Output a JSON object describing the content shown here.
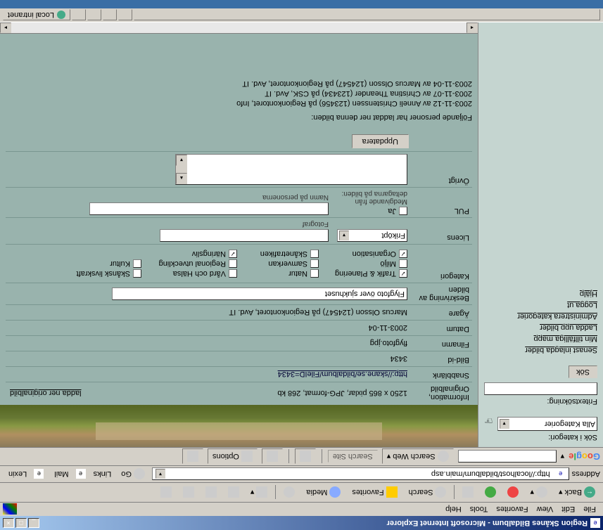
{
  "titlebar": {
    "text": "Region Skånes Bildalbum - Microsoft Internet Explorer"
  },
  "menu": {
    "file": "File",
    "edit": "Edit",
    "view": "View",
    "favorites": "Favorites",
    "tools": "Tools",
    "help": "Help"
  },
  "toolbar": {
    "back": "Back",
    "search": "Search",
    "favorites": "Favorites",
    "media": "Media"
  },
  "address": {
    "label": "Address",
    "url": "http://localhost/bildalbum/main.asp",
    "go": "Go",
    "links": "Links",
    "mail": "Mail",
    "lexin": "Lexin"
  },
  "google": {
    "searchweb": "Search Web",
    "searchsite": "Search Site",
    "options": "Options"
  },
  "sidebar": {
    "category_label": "Sök i kategori:",
    "category_value": "Alla Kategorier",
    "freetext_label": "Fritextsökning:",
    "search_btn": "Sök",
    "links": {
      "recent": "Senast inlagda bilder",
      "tempfolder": "Min tillfälliga mapp",
      "upload": "Ladda upp bilder",
      "admin": "Administrera kategorier",
      "logout": "Logga ut",
      "help": "Hjälp"
    }
  },
  "form": {
    "info_label": "Information, Originalbild",
    "info_value": "1250 x 865 pixlar, JPG-format, 268 kb",
    "download_link": "ladda ner originalbild",
    "quicklink_label": "Snabblänk",
    "quicklink_value": "http://skane.se/bildalbum/FileID=3434",
    "id_label": "Bild-id",
    "id_value": "3434",
    "filename_label": "Filnamn",
    "filename_value": "flygfoto.jpg",
    "date_label": "Datum",
    "date_value": "2003-11-04",
    "owner_label": "Ägare",
    "owner_value": "Marcus Olsson (124547) på Regionkontoret, Avd. IT",
    "desc_label": "Beskrivning av bilden",
    "desc_value": "Flygfoto över sjukhuset",
    "category_label": "Kategori",
    "cats": {
      "trafik": "Trafik & Planering",
      "natur": "Natur",
      "vard": "Vård och Hälsa",
      "livskraft": "Skånsk livskraft",
      "miljo": "Miljö",
      "samverkan": "Samverkan",
      "regional": "Regional utveckling",
      "kultur": "Kultur",
      "organisation": "Organisation",
      "skanetrafiken": "Skånetrafiken",
      "naringsliv": "Näringsliv"
    },
    "license_label": "Licens",
    "license_value": "Friköpt",
    "photographer_label": "Fotograf",
    "pul_label": "PUL",
    "consent_label": "Medgivande från deltagarna på bilden:",
    "consent_yes": "Ja",
    "names_label": "Namn på personerna",
    "other_label": "Övrigt",
    "update_btn": "Uppdatera"
  },
  "downloads": {
    "title": "Följande personer har laddat ner denna bilden:",
    "lines": [
      "2003-11-12 av Anneli Christenssen (123456) på Regionkontoret, Info",
      "2003-11-07 av Christina Theander (123434) på CSK, Avd. IT",
      "2003-11-04 av Marcus Olsson (124547) på Regionkontoret, Avd. IT"
    ]
  },
  "statusbar": {
    "zone": "Local intranet"
  }
}
